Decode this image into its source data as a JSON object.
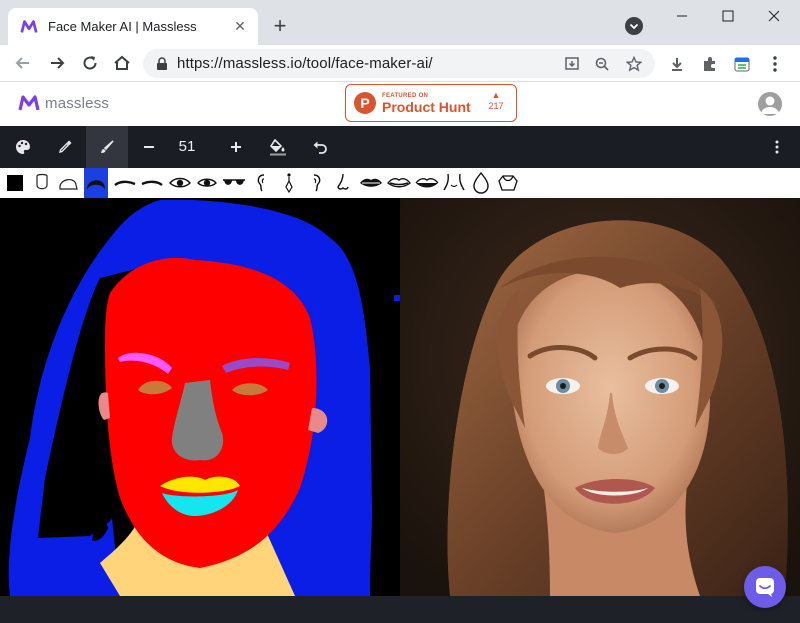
{
  "browser": {
    "tab": {
      "title": "Face Maker AI | Massless",
      "favicon": "massless-logo-icon"
    },
    "omnibox": {
      "url": "https://massless.io/tool/face-maker-ai/"
    }
  },
  "site": {
    "logo_text": "massless",
    "product_hunt": {
      "small_text": "FEATURED ON",
      "big_text": "Product Hunt",
      "votes": "217"
    }
  },
  "app": {
    "brush_size": "51",
    "tools": [
      "palette-icon",
      "eyedropper-icon",
      "brush-icon",
      "minus-icon",
      "plus-icon",
      "fill-bucket-icon",
      "undo-icon",
      "more-vert-icon"
    ],
    "palette": [
      "background-swatch",
      "face-outline-swatch",
      "head-outline-swatch",
      "hair-swatch",
      "left-brow-swatch",
      "right-brow-swatch",
      "left-eye-swatch",
      "right-eye-swatch",
      "glasses-swatch",
      "left-ear-swatch",
      "earring-swatch",
      "right-ear-swatch",
      "nose-swatch",
      "upper-lip-swatch",
      "mouth-swatch",
      "lower-lip-swatch",
      "neck-swatch",
      "necklace-swatch",
      "cloth-swatch"
    ],
    "selected_palette": "hair-swatch"
  },
  "colors": {
    "accent_orange": "#da552f",
    "hair_blue": "#0a1ee6",
    "skin_red": "#ff0000",
    "chat_purple": "#6c5ce7"
  }
}
